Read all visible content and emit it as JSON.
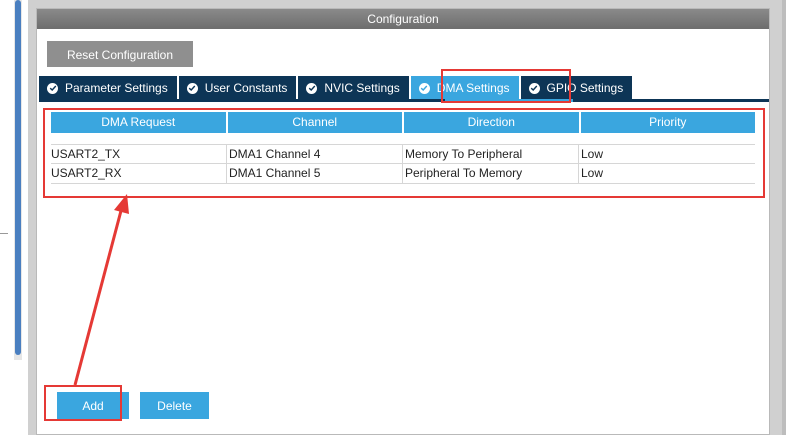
{
  "window": {
    "title": "Configuration"
  },
  "toolbar": {
    "reset_label": "Reset Configuration"
  },
  "tabs": [
    {
      "label": "Parameter Settings",
      "icon": "check-circle-icon",
      "active": false
    },
    {
      "label": "User Constants",
      "icon": "check-circle-icon",
      "active": false
    },
    {
      "label": "NVIC Settings",
      "icon": "check-circle-icon",
      "active": false
    },
    {
      "label": "DMA Settings",
      "icon": "check-circle-icon",
      "active": true
    },
    {
      "label": "GPIO Settings",
      "icon": "check-circle-icon",
      "active": false
    }
  ],
  "dma_table": {
    "headers": [
      "DMA Request",
      "Channel",
      "Direction",
      "Priority"
    ],
    "rows": [
      [
        "USART2_TX",
        "DMA1 Channel 4",
        "Memory To Peripheral",
        "Low"
      ],
      [
        "USART2_RX",
        "DMA1 Channel 5",
        "Peripheral To Memory",
        "Low"
      ]
    ]
  },
  "actions": {
    "add_label": "Add",
    "delete_label": "Delete"
  },
  "colors": {
    "tab_dark": "#0d3556",
    "accent": "#3aa6df",
    "annotation_red": "#e53935",
    "title_bar": "#7a7a7a",
    "reset_button": "#8f8f8f"
  }
}
